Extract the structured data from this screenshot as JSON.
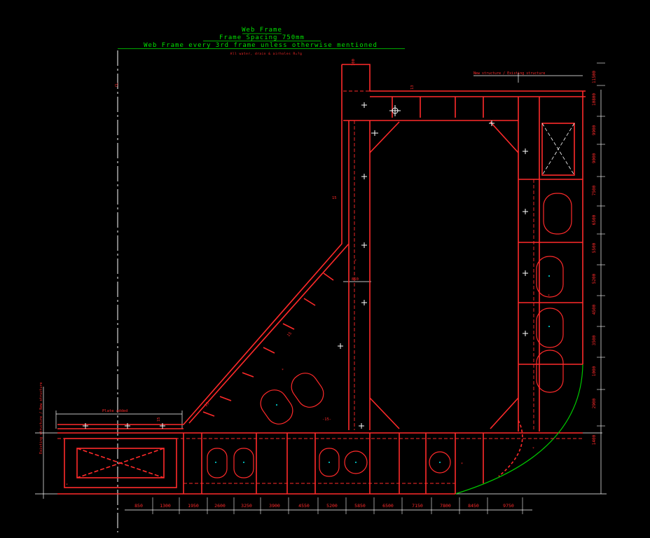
{
  "title": {
    "line1": "Web Frame",
    "line2": "Frame Spacing 750mm",
    "line3": "Web Frame every 3rd  frame unless otherwise mentioned",
    "line4": "All water, drain & airholes R=?g"
  },
  "notes": {
    "new_existing": "New structure / Existing structure",
    "existing_vertical": "Existing structure / New structure",
    "plate_added": "Plate added",
    "cl": "CL",
    "plate_100": "100",
    "plate_13a": "13",
    "plate_15a": "15",
    "plate_15b": "15",
    "plate_15c": "15",
    "plate_15d": "15",
    "width_850": "850",
    "thk_15": "-15-"
  },
  "horizontal_dims": [
    "850",
    "1300",
    "1950",
    "2600",
    "3250",
    "3900",
    "4550",
    "5200",
    "5850",
    "6500",
    "7150",
    "7800",
    "8450",
    "9750"
  ],
  "vertical_dims": [
    "1400",
    "2900",
    "1000",
    "3500",
    "4500",
    "5200",
    "5500",
    "6500",
    "7500",
    "9000",
    "9900",
    "10800",
    "11500"
  ],
  "colors": {
    "structure": "#ff2a2a",
    "annotation": "#ffffff",
    "title": "#00e000",
    "marker": "#00e5e5",
    "hull_curve": "#00c800",
    "background": "#000000"
  }
}
